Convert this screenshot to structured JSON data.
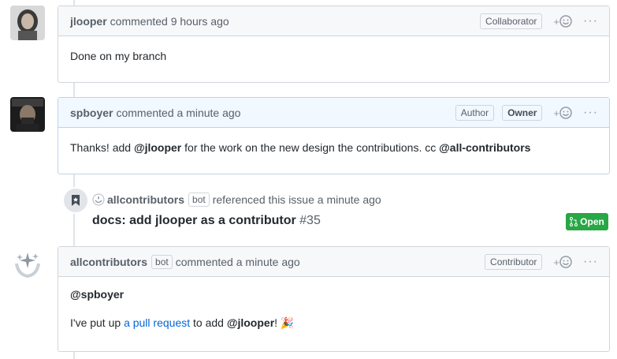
{
  "comments": [
    {
      "author": "jlooper",
      "meta": "commented 9 hours ago",
      "badges": [
        "Collaborator"
      ],
      "body": "Done on my branch"
    },
    {
      "author": "spboyer",
      "meta": "commented a minute ago",
      "badges": [
        "Author",
        "Owner"
      ],
      "body_prefix": "Thanks! add ",
      "body_mention1": "@jlooper",
      "body_middle": " for the work on the new design the contributions. cc ",
      "body_mention2": "@all-contributors"
    },
    {
      "author": "allcontributors",
      "bot_label": "bot",
      "meta": "commented a minute ago",
      "badges": [
        "Contributor"
      ],
      "body_line1": "@spboyer",
      "body_line2_prefix": "I've put up ",
      "body_link": "a pull request",
      "body_line2_middle": " to add ",
      "body_mention": "@jlooper",
      "body_line2_suffix": "! 🎉"
    }
  ],
  "reference_event": {
    "author": "allcontributors",
    "bot_label": "bot",
    "text": "referenced this issue a minute ago",
    "title": "docs: add jlooper as a contributor",
    "number": "#35",
    "status": "Open"
  },
  "actions": {
    "add_reaction": "+",
    "more": "···"
  },
  "colors": {
    "open_green": "#28a745",
    "owner_header_bg": "#f1f8ff",
    "link_blue": "#0366d6"
  }
}
